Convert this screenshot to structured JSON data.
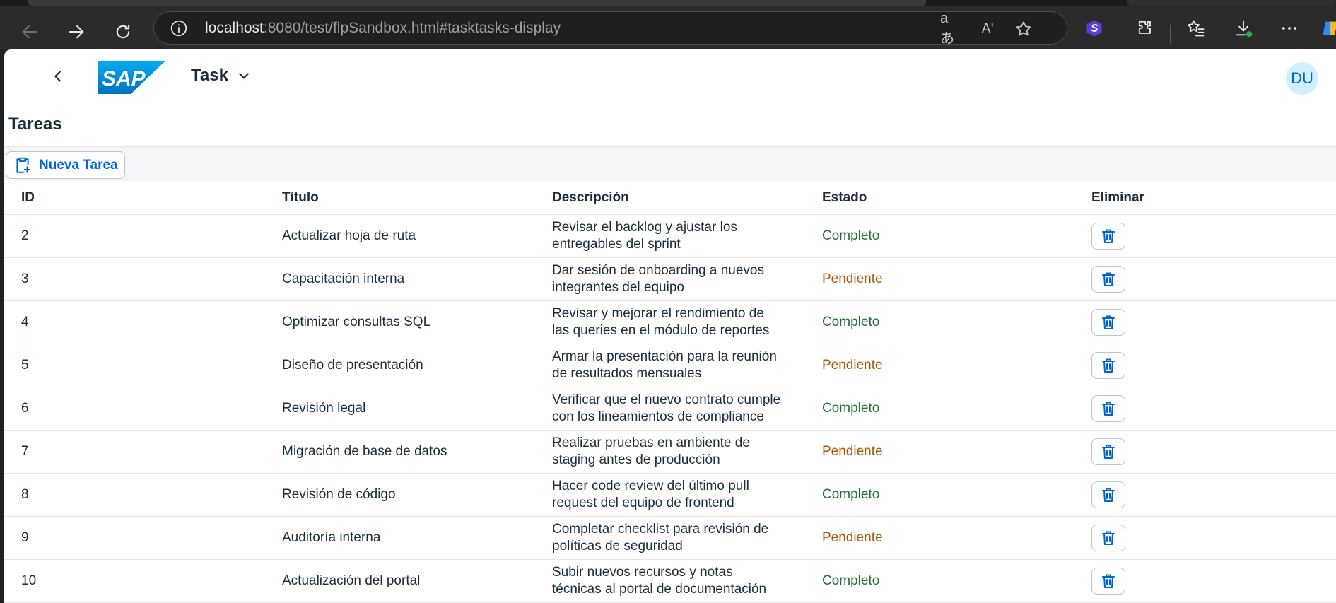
{
  "browser": {
    "url_host": "localhost",
    "url_rest": ":8080/test/flpSandbox.html#tasktasks-display",
    "read_aloud_label": "Aʹ",
    "translate_label": "aあ"
  },
  "shell": {
    "logo_text": "SAP",
    "app_title": "Task",
    "avatar_initials": "DU"
  },
  "page": {
    "title": "Tareas",
    "new_button_label": "Nueva Tarea"
  },
  "table": {
    "headers": {
      "id": "ID",
      "title": "Título",
      "description": "Descripción",
      "status": "Estado",
      "delete": "Eliminar"
    },
    "rows": [
      {
        "id": "2",
        "title": "Actualizar hoja de ruta",
        "desc1": "Revisar el backlog y ajustar los",
        "desc2": "entregables del sprint",
        "status": "Completo"
      },
      {
        "id": "3",
        "title": "Capacitación interna",
        "desc1": "Dar sesión de onboarding a nuevos",
        "desc2": "integrantes del equipo",
        "status": "Pendiente"
      },
      {
        "id": "4",
        "title": "Optimizar consultas SQL",
        "desc1": "Revisar y mejorar el rendimiento de",
        "desc2": "las queries en el módulo de reportes",
        "status": "Completo"
      },
      {
        "id": "5",
        "title": "Diseño de presentación",
        "desc1": "Armar la presentación para la reunión",
        "desc2": "de resultados mensuales",
        "status": "Pendiente"
      },
      {
        "id": "6",
        "title": "Revisión legal",
        "desc1": "Verificar que el nuevo contrato cumple",
        "desc2": "con los lineamientos de compliance",
        "status": "Completo"
      },
      {
        "id": "7",
        "title": "Migración de base de datos",
        "desc1": "Realizar pruebas en ambiente de",
        "desc2": "staging antes de producción",
        "status": "Pendiente"
      },
      {
        "id": "8",
        "title": "Revisión de código",
        "desc1": "Hacer code review del último pull",
        "desc2": "request del equipo de frontend",
        "status": "Completo"
      },
      {
        "id": "9",
        "title": "Auditoría interna",
        "desc1": "Completar checklist para revisión de",
        "desc2": "políticas de seguridad",
        "status": "Pendiente"
      },
      {
        "id": "10",
        "title": "Actualización del portal",
        "desc1": "Subir nuevos recursos y notas",
        "desc2": "técnicas al portal de documentación",
        "status": "Completo"
      }
    ]
  },
  "colors": {
    "accent": "#0064d9",
    "status_complete": "#256f3a",
    "status_pending": "#aa5808",
    "sap_blue": "#0a6ed1"
  }
}
